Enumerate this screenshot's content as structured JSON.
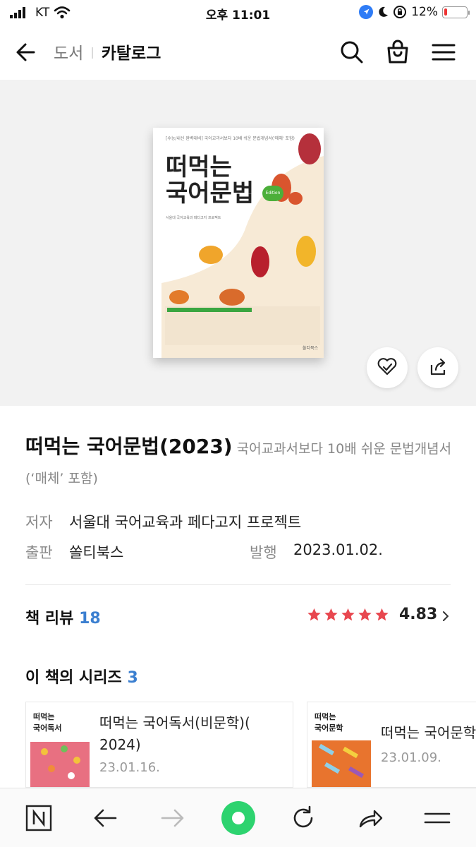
{
  "status_bar": {
    "carrier": "KT",
    "time": "오후 11:01",
    "battery_percent": "12%",
    "battery_level": 0.12
  },
  "header": {
    "category": "도서",
    "title": "카탈로그",
    "icons": [
      "back-arrow-icon",
      "search-icon",
      "shopping-bag-icon",
      "menu-icon"
    ]
  },
  "cover": {
    "top_text": "[수능/내신 완벽대비]  국어교과서보다 10배 쉬운 문법개념서('매체' 포함)",
    "title_line1": "떠먹는",
    "title_line2": "국어문법",
    "edition": "Edition",
    "authors": "서울대 국어교육과 페다고지 프로젝트",
    "publisher": "쏠티북스",
    "actions": [
      "wishlist-icon",
      "share-icon"
    ]
  },
  "book": {
    "title": "떠먹는 국어문법(2023)",
    "subtitle": "국어교과서보다 10배 쉬운 문법개념서(‘매체’ 포함)",
    "author_label": "저자",
    "author": "서울대 국어교육과 페다고지 프로젝트",
    "publisher_label": "출판",
    "publisher": "쏠티북스",
    "published_label": "발행",
    "published_date": "2023.01.02."
  },
  "reviews": {
    "label": "책 리뷰",
    "count": "18",
    "rating": "4.83",
    "stars": 5,
    "star_color": "#e8474f"
  },
  "series": {
    "label": "이 책의 시리즈",
    "count": "3",
    "items": [
      {
        "title_line1": "떠먹는 국어독서(비문학)(",
        "title_line2": "2024)",
        "date": "23.01.16."
      },
      {
        "title_line1": "떠먹는 국어문학",
        "title_line2": "",
        "date": "23.01.09."
      }
    ]
  },
  "toolbar": {
    "icons": [
      "naver-n-icon",
      "back-icon",
      "forward-icon",
      "home-green-dot-icon",
      "refresh-icon",
      "share-icon",
      "menu-icon"
    ],
    "accent": "#2dd36f"
  }
}
